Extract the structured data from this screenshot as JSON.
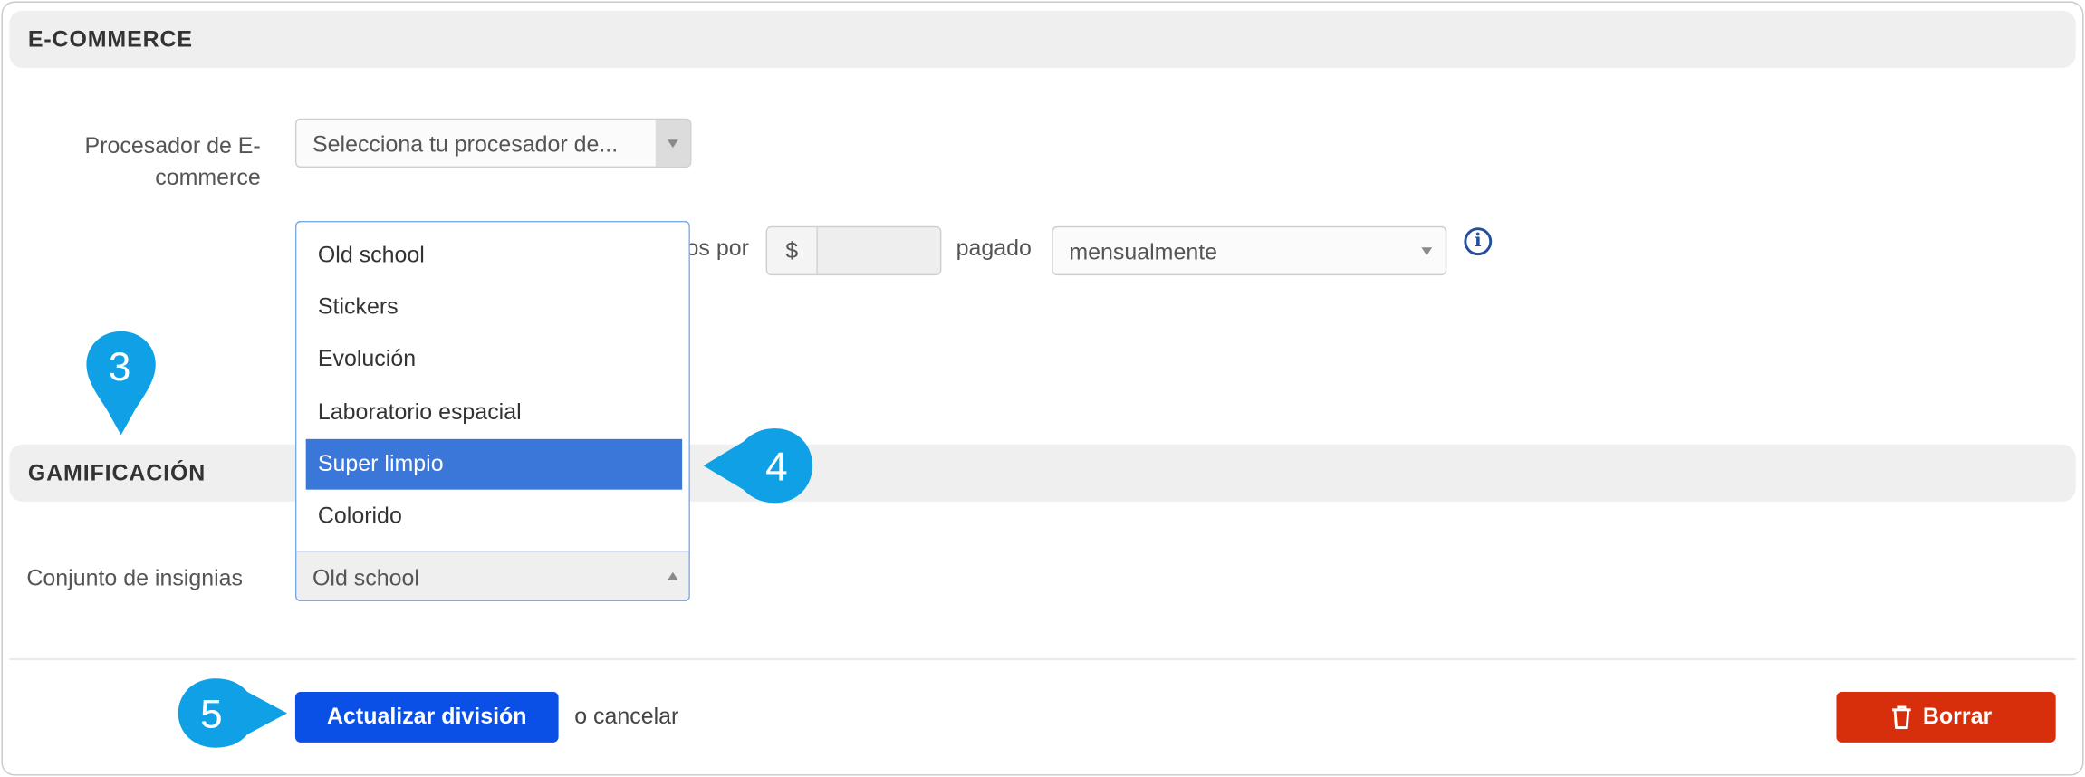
{
  "ecommerce": {
    "title": "E-COMMERCE",
    "processor_label": "Procesador de E-commerce",
    "processor_label_line1": "Procesador de E-",
    "processor_label_line2": "commerce",
    "processor_value": "Selecciona tu procesador de...",
    "price_label_fragment": "os por",
    "currency_symbol": "$",
    "price_value": "",
    "paid_label": "pagado",
    "frequency_value": "mensualmente"
  },
  "gamification": {
    "title": "GAMIFICACIÓN",
    "badge_set_label": "Conjunto de insignias",
    "badge_set_value": "Old school",
    "options": [
      "Old school",
      "Stickers",
      "Evolución",
      "Laboratorio espacial",
      "Super limpio",
      "Colorido"
    ],
    "highlighted_option": "Super limpio"
  },
  "actions": {
    "submit_label": "Actualizar división",
    "cancel_text": "o cancelar",
    "delete_label": "Borrar"
  },
  "callouts": [
    "3",
    "4",
    "5"
  ],
  "icons": {
    "info": "info-icon",
    "trash": "trash-icon",
    "caret": "caret-down-icon"
  },
  "colors": {
    "primary_button": "#0a4fe6",
    "danger_button": "#d72f0c",
    "highlight": "#3a77d9",
    "callout": "#0fa0e6",
    "info_icon": "#234f9d"
  }
}
